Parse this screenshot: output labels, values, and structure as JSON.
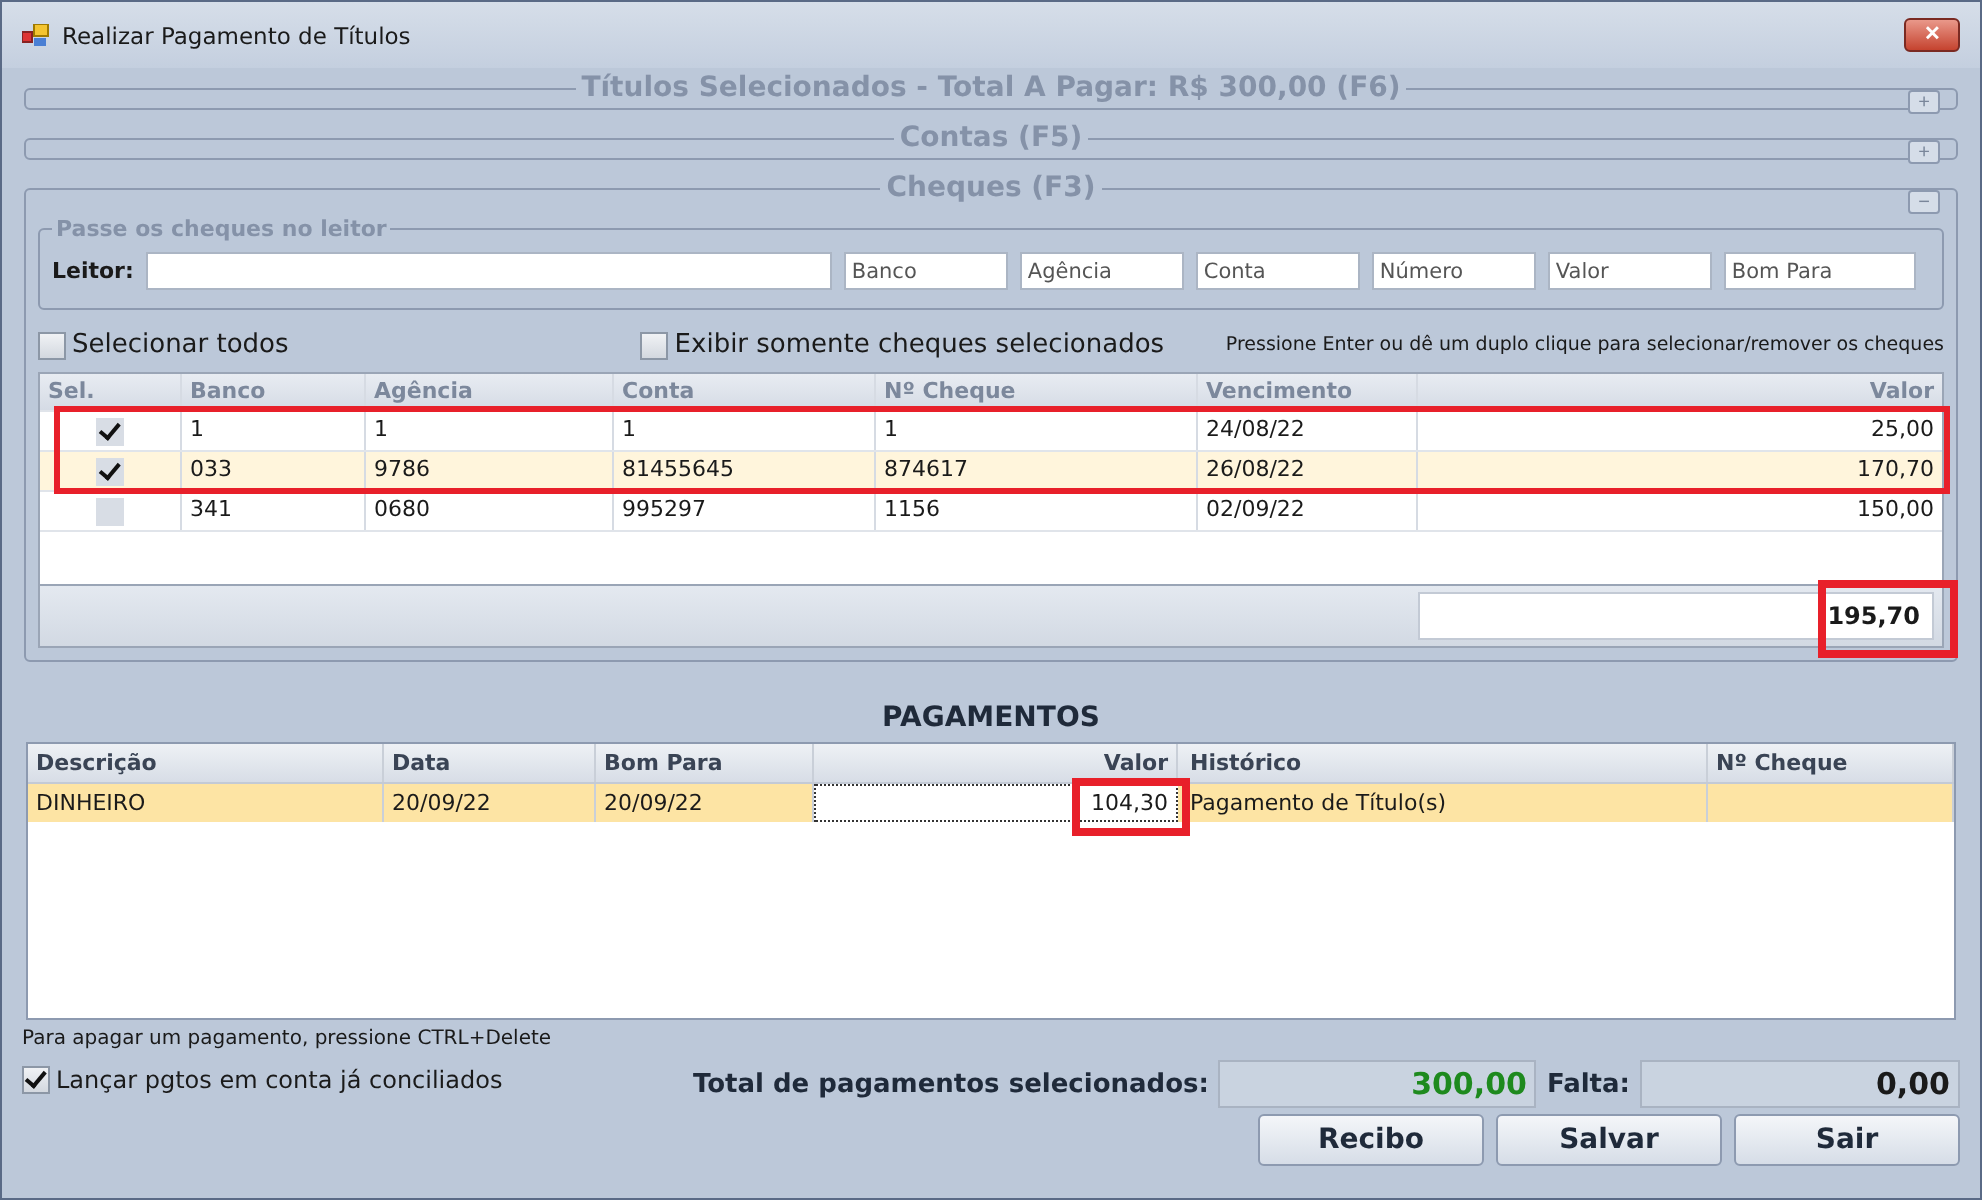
{
  "window": {
    "title": "Realizar Pagamento de Títulos",
    "close": "✕"
  },
  "sections": [
    {
      "title": "Títulos Selecionados - Total A Pagar: R$ 300,00 (F6)",
      "expanded": false,
      "toggle": "+"
    },
    {
      "title": "Contas (F5)",
      "expanded": false,
      "toggle": "+"
    },
    {
      "title": "Cheques (F3)",
      "expanded": true,
      "toggle": "−"
    }
  ],
  "cheques": {
    "reader": {
      "legend": "Passe os cheques no leitor",
      "label": "Leitor:",
      "placeholders": [
        "Banco",
        "Agência",
        "Conta",
        "Número",
        "Valor",
        "Bom Para"
      ]
    },
    "select_all": {
      "label": "Selecionar todos",
      "checked": false
    },
    "only_selected": {
      "label": "Exibir somente cheques selecionados",
      "checked": false
    },
    "hint": "Pressione Enter ou dê um duplo clique para selecionar/remover os cheques",
    "columns": [
      "Sel.",
      "Banco",
      "Agência",
      "Conta",
      "Nº Cheque",
      "Vencimento",
      "Valor"
    ],
    "rows": [
      {
        "checked": true,
        "selected": false,
        "highlighted": true,
        "cells": [
          "",
          "1",
          "1",
          "1",
          "1",
          "24/08/22",
          "25,00"
        ]
      },
      {
        "checked": true,
        "selected": true,
        "highlighted": true,
        "cells": [
          "",
          "033",
          "9786",
          "81455645",
          "874617",
          "26/08/22",
          "170,70"
        ]
      },
      {
        "checked": false,
        "selected": false,
        "highlighted": false,
        "cells": [
          "",
          "341",
          "0680",
          "995297",
          "1156",
          "02/09/22",
          "150,00"
        ]
      }
    ],
    "total": {
      "value": "195,70",
      "highlighted": true
    }
  },
  "payments": {
    "title": "PAGAMENTOS",
    "columns": [
      "Descrição",
      "Data",
      "Bom Para",
      "Valor",
      "Histórico",
      "Nº Cheque"
    ],
    "rows": [
      {
        "selected": true,
        "value_highlighted": true,
        "cells": [
          "DINHEIRO",
          "20/09/22",
          "20/09/22",
          "104,30",
          "Pagamento de Título(s)",
          ""
        ]
      }
    ],
    "hint": "Para apagar um pagamento, pressione CTRL+Delete",
    "conciliated": {
      "label": "Lançar pgtos em conta já conciliados",
      "checked": true
    },
    "total_label": "Total de pagamentos selecionados:",
    "total_value": "300,00",
    "missing_label": "Falta:",
    "missing_value": "0,00"
  },
  "buttons": [
    "Recibo",
    "Salvar",
    "Sair"
  ]
}
